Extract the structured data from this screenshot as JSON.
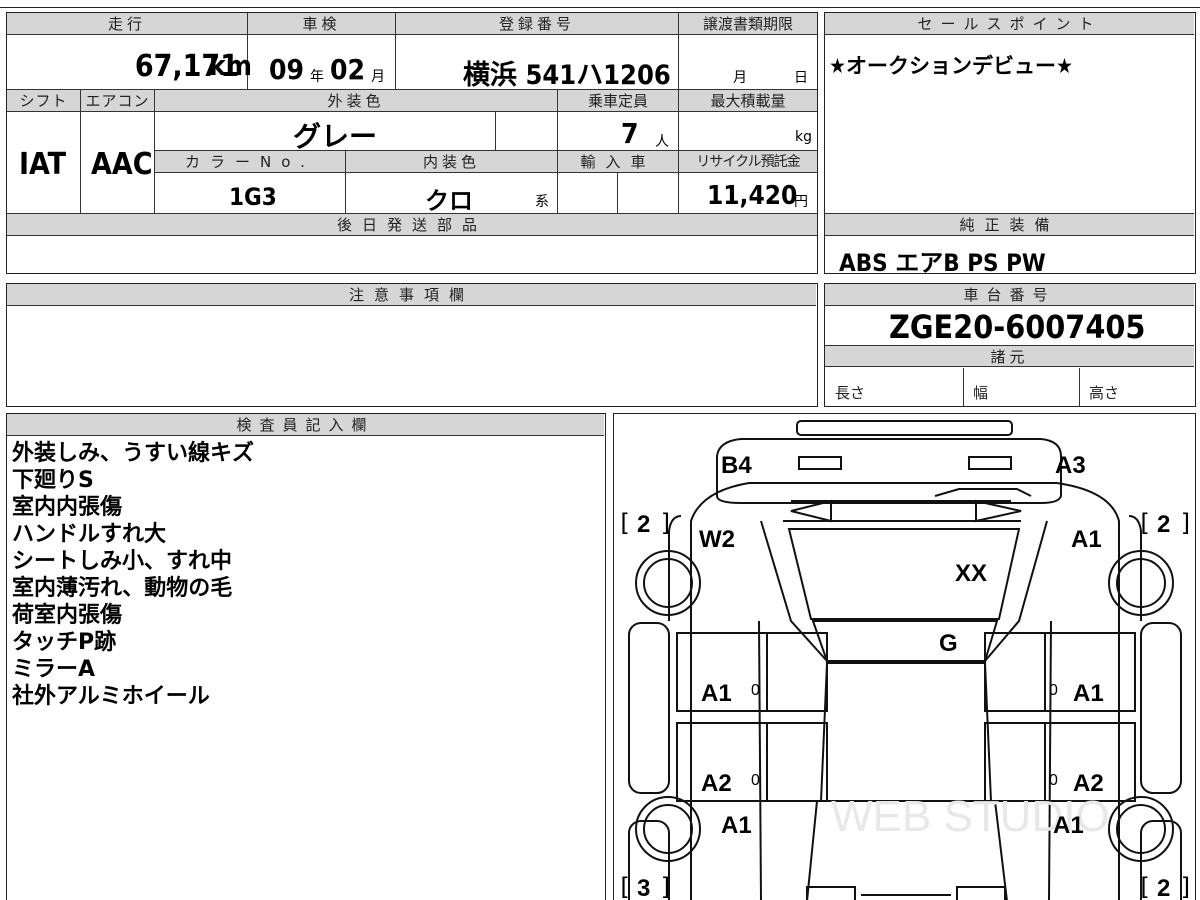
{
  "top": {
    "mileage_label": "走行",
    "mileage_value": "67,171",
    "mileage_unit": "km",
    "inspection_label": "車検",
    "inspection_year": "09",
    "inspection_year_unit": "年",
    "inspection_month": "02",
    "inspection_month_unit": "月",
    "registration_label": "登録番号",
    "registration_value": "横浜 541ハ1206",
    "transfer_label": "譲渡書類期限",
    "transfer_month_unit": "月",
    "transfer_day_unit": "日",
    "sales_point_label": "セールスポイント",
    "sales_point_value": "★オークションデビュー★"
  },
  "second": {
    "shift_label": "シフト",
    "shift_value": "IAT",
    "aircon_label": "エアコン",
    "aircon_value": "AAC",
    "exterior_color_label": "外装色",
    "exterior_color_value": "グレー",
    "capacity_label": "乗車定員",
    "capacity_value": "7",
    "capacity_unit": "人",
    "max_load_label": "最大積載量",
    "max_load_unit": "kg",
    "color_no_label": "カラーNo.",
    "color_no_value": "1G3",
    "interior_color_label": "内装色",
    "interior_color_value": "クロ",
    "interior_color_unit": "系",
    "import_label": "輸入車",
    "recycle_label": "リサイクル預託金",
    "recycle_value": "11,420",
    "recycle_unit": "円"
  },
  "later_parts_label": "後日発送部品",
  "genuine_equipment_label": "純正装備",
  "genuine_equipment_value": "ABS エアB PS PW",
  "caution_label": "注意事項欄",
  "chassis_label": "車台番号",
  "chassis_value": "ZGE20-6007405",
  "specs_label": "諸元",
  "spec_length": "長さ",
  "spec_width": "幅",
  "spec_height": "高さ",
  "inspector_label": "検査員記入欄",
  "inspector_notes": [
    "外装しみ、うすい線キズ",
    "下廻りS",
    "室内内張傷",
    "ハンドルすれ大",
    "シートしみ小、すれ中",
    "室内薄汚れ、動物の毛",
    "荷室内張傷",
    "タッチP跡",
    "ミラーA",
    "社外アルミホイール"
  ],
  "diagram": {
    "marks": {
      "b4": "B4",
      "a3": "A3",
      "w2": "W2",
      "a1_rf": "A1",
      "xx": "XX",
      "g": "G",
      "a1_lfd": "A1",
      "a1_rfd": "A1",
      "a2_lrd": "A2",
      "a2_rrd": "A2",
      "a1_lq": "A1",
      "a1_rq": "A1",
      "zero_1": "0",
      "zero_2": "0",
      "zero_3": "0",
      "zero_4": "0"
    },
    "tire_left_front": "2",
    "tire_right_front": "2",
    "tire_left_rear": "3",
    "tire_right_rear": "2",
    "watermark": "WEB STUDIO"
  }
}
